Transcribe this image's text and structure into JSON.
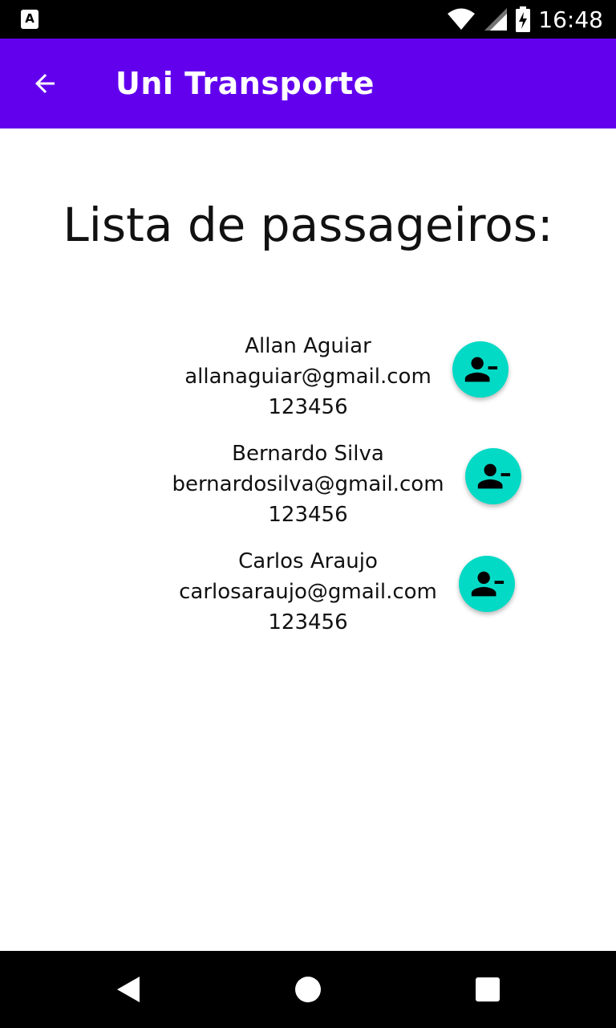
{
  "status_bar": {
    "time": "16:48",
    "icons": [
      "app-notification-icon",
      "wifi-icon",
      "signal-icon",
      "battery-charging-icon"
    ]
  },
  "app_bar": {
    "title": "Uni Transporte",
    "back_icon": "arrow-back-icon"
  },
  "heading": "Lista de passageiros:",
  "passengers": [
    {
      "name": "Allan Aguiar",
      "email": "allanaguiar@gmail.com",
      "code": "123456",
      "action_icon": "person-remove-icon"
    },
    {
      "name": "Bernardo Silva",
      "email": "bernardosilva@gmail.com",
      "code": "123456",
      "action_icon": "person-remove-icon"
    },
    {
      "name": "Carlos Araujo",
      "email": "carlosaraujo@gmail.com",
      "code": "123456",
      "action_icon": "person-remove-icon"
    }
  ],
  "colors": {
    "app_bar": "#6200ee",
    "fab": "#03dac5",
    "system_bars": "#000000"
  },
  "nav_bar": {
    "icons": [
      "back-triangle-icon",
      "home-circle-icon",
      "recents-square-icon"
    ]
  }
}
